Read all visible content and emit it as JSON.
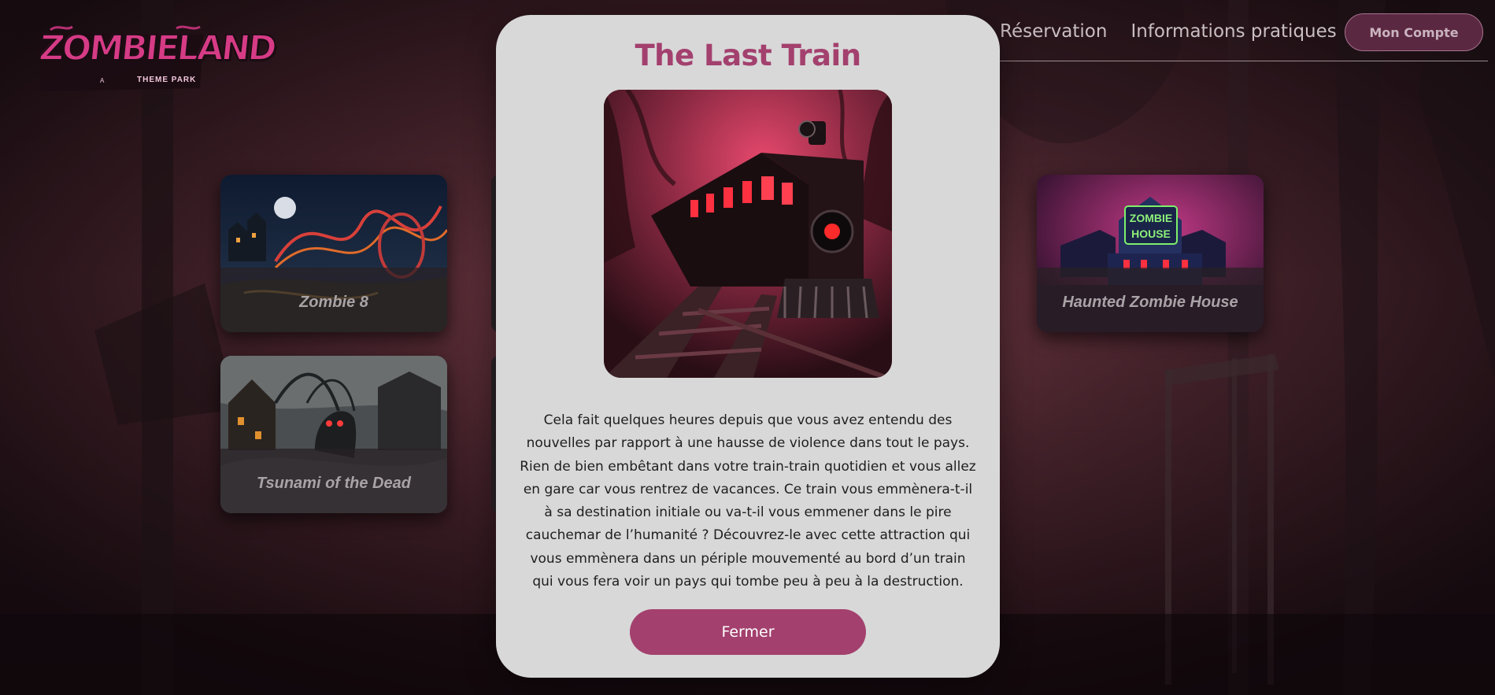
{
  "header": {
    "logo": {
      "main": "ZOMBIELAND",
      "a": "A",
      "sub": "THEME PARK"
    },
    "nav": [
      {
        "label": "Réservation"
      },
      {
        "label": "Informations pratiques"
      }
    ],
    "account_label": "Mon Compte"
  },
  "cards": [
    {
      "title": "Zombie 8"
    },
    {
      "title": "Tsunami of the Dead"
    },
    {
      "title": "Haunted Zombie House",
      "sign": [
        "ZOMBIE",
        "HOUSE"
      ]
    }
  ],
  "modal": {
    "title": "The Last Train",
    "description": "Cela fait quelques heures depuis que vous avez entendu des nouvelles par rapport à une hausse de violence dans tout le pays. Rien de bien embêtant dans votre train-train quotidien et vous allez en gare car vous rentrez de vacances. Ce train vous emmènera-t-il à sa destination initiale ou va-t-il vous emmener dans le pire cauchemar de l’humanité ? Découvrez-le avec cette attraction qui vous emmènera dans un périple mouvementé au bord d’un train qui vous fera voir un pays qui tombe peu à peu à la destruction.",
    "close_label": "Fermer"
  },
  "colors": {
    "accent": "#a3406e",
    "modal_bg": "#d8d8d8",
    "account_bg": "#5b2841"
  }
}
